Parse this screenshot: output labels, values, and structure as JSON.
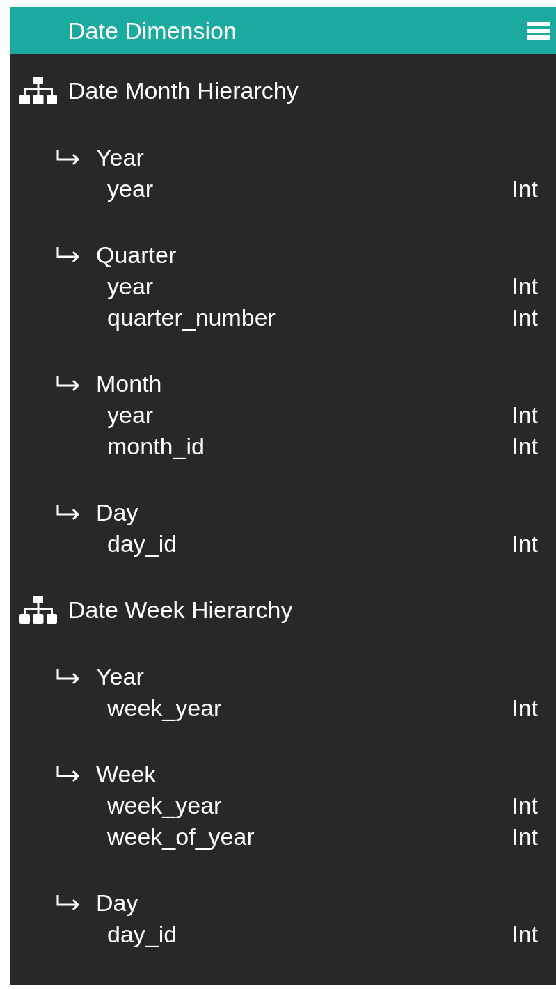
{
  "header": {
    "title": "Date Dimension"
  },
  "hierarchies": [
    {
      "name": "Date Month Hierarchy",
      "levels": [
        {
          "name": "Year",
          "attributes": [
            {
              "name": "year",
              "type": "Int"
            }
          ]
        },
        {
          "name": "Quarter",
          "attributes": [
            {
              "name": "year",
              "type": "Int"
            },
            {
              "name": "quarter_number",
              "type": "Int"
            }
          ]
        },
        {
          "name": "Month",
          "attributes": [
            {
              "name": "year",
              "type": "Int"
            },
            {
              "name": "month_id",
              "type": "Int"
            }
          ]
        },
        {
          "name": "Day",
          "attributes": [
            {
              "name": "day_id",
              "type": "Int"
            }
          ]
        }
      ]
    },
    {
      "name": "Date Week Hierarchy",
      "levels": [
        {
          "name": "Year",
          "attributes": [
            {
              "name": "week_year",
              "type": "Int"
            }
          ]
        },
        {
          "name": "Week",
          "attributes": [
            {
              "name": "week_year",
              "type": "Int"
            },
            {
              "name": "week_of_year",
              "type": "Int"
            }
          ]
        },
        {
          "name": "Day",
          "attributes": [
            {
              "name": "day_id",
              "type": "Int"
            }
          ]
        }
      ]
    }
  ]
}
